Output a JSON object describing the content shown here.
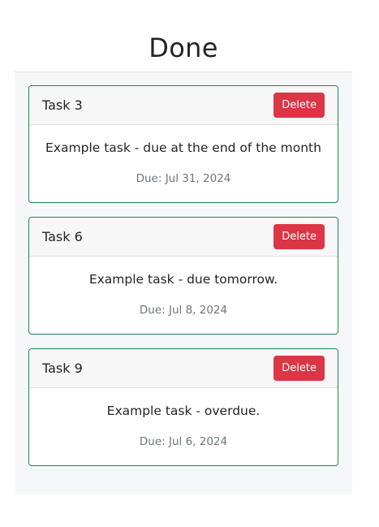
{
  "column": {
    "title": "Done"
  },
  "tasks": [
    {
      "title": "Task 3",
      "description": "Example task - due at the end of the month",
      "due": "Due: Jul 31, 2024",
      "delete_label": "Delete"
    },
    {
      "title": "Task 6",
      "description": "Example task - due tomorrow.",
      "due": "Due: Jul 8, 2024",
      "delete_label": "Delete"
    },
    {
      "title": "Task 9",
      "description": "Example task - overdue.",
      "due": "Due: Jul 6, 2024",
      "delete_label": "Delete"
    }
  ],
  "colors": {
    "card_border": "#198754",
    "delete_button": "#dc3545",
    "column_background": "#f6f7f8"
  }
}
